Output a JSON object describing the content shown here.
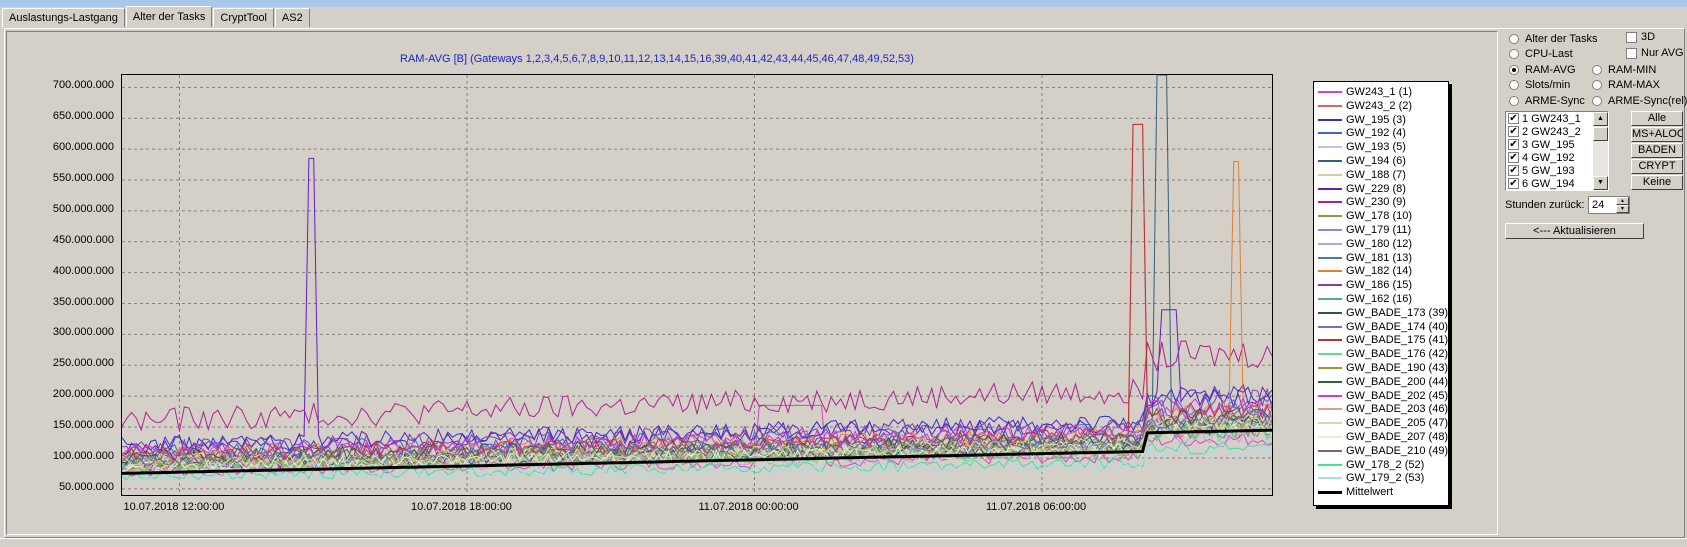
{
  "tabs": [
    {
      "label": "Auslastungs-Lastgang",
      "active": false
    },
    {
      "label": "Alter der Tasks",
      "active": true
    },
    {
      "label": "CryptTool",
      "active": false
    },
    {
      "label": "AS2",
      "active": false
    }
  ],
  "controls": {
    "radios": [
      {
        "label": "Alter der Tasks",
        "checked": false
      },
      {
        "label": "CPU-Last",
        "checked": false
      },
      {
        "label": "RAM-AVG",
        "checked": true
      },
      {
        "label": "RAM-MIN",
        "checked": false
      },
      {
        "label": "Slots/min",
        "checked": false
      },
      {
        "label": "RAM-MAX",
        "checked": false
      },
      {
        "label": "ARME-Sync",
        "checked": false
      },
      {
        "label": "ARME-Sync(rel)",
        "checked": false
      }
    ],
    "checks": [
      {
        "label": "3D",
        "checked": false
      },
      {
        "label": "Nur AVG",
        "checked": false
      }
    ],
    "gateway_list": [
      {
        "label": "1 GW243_1",
        "checked": true
      },
      {
        "label": "2 GW243_2",
        "checked": true
      },
      {
        "label": "3 GW_195",
        "checked": true
      },
      {
        "label": "4 GW_192",
        "checked": true
      },
      {
        "label": "5 GW_193",
        "checked": true
      },
      {
        "label": "6 GW_194",
        "checked": true
      }
    ],
    "buttons": {
      "all": "Alle",
      "ms_aloc": "MS+ALOC",
      "baden": "BADEN",
      "crypt": "CRYPT",
      "none": "Keine",
      "refresh": "<--- Aktualisieren"
    },
    "hours_label": "Stunden zurück:",
    "hours_value": "24"
  },
  "chart_data": {
    "type": "line",
    "title": "RAM-AVG [B] (Gateways 1,2,3,4,5,6,7,8,9,10,11,12,13,14,15,16,39,40,41,42,43,44,45,46,47,48,49,52,53)",
    "xlabel": "",
    "ylabel": "",
    "ylim": [
      40000000,
      720000000
    ],
    "xlim_hours": [
      0,
      24
    ],
    "grid": true,
    "legend_position": "right",
    "y_ticks": [
      "700.000.000",
      "650.000.000",
      "600.000.000",
      "550.000.000",
      "500.000.000",
      "450.000.000",
      "400.000.000",
      "350.000.000",
      "300.000.000",
      "250.000.000",
      "200.000.000",
      "150.000.000",
      "100.000.000",
      "50.000.000"
    ],
    "x_ticks": [
      {
        "label": "10.07.2018 12:00:00",
        "hour": 1.2
      },
      {
        "label": "10.07.2018 18:00:00",
        "hour": 7.2
      },
      {
        "label": "11.07.2018 00:00:00",
        "hour": 13.2
      },
      {
        "label": "11.07.2018 06:00:00",
        "hour": 19.2
      }
    ],
    "series": [
      {
        "name": "GW243_1 (1)",
        "color": "#e040c0",
        "base": 78000000,
        "spikes": [
          [
            13.3,
            14.6,
            185000000
          ]
        ]
      },
      {
        "name": "GW243_2 (2)",
        "color": "#e06060",
        "base": 85000000,
        "spikes": [
          [
            21.1,
            21.3,
            640000000
          ]
        ]
      },
      {
        "name": "GW_195 (3)",
        "color": "#3030d0",
        "base": 120000000,
        "spikes": []
      },
      {
        "name": "GW_192 (4)",
        "color": "#4060e0",
        "base": 110000000,
        "spikes": []
      },
      {
        "name": "GW_193 (5)",
        "color": "#c0c0e0",
        "base": 95000000,
        "spikes": []
      },
      {
        "name": "GW_194 (6)",
        "color": "#306080",
        "base": 100000000,
        "spikes": [
          [
            21.6,
            21.8,
            720000000
          ]
        ]
      },
      {
        "name": "GW_188 (7)",
        "color": "#d0d0a0",
        "base": 90000000,
        "spikes": []
      },
      {
        "name": "GW_229 (8)",
        "color": "#6020c0",
        "base": 120000000,
        "spikes": [
          [
            3.9,
            4.0,
            585000000
          ],
          [
            21.7,
            22.0,
            340000000
          ]
        ]
      },
      {
        "name": "GW_230 (9)",
        "color": "#b02090",
        "base": 160000000,
        "spikes": []
      },
      {
        "name": "GW_178 (10)",
        "color": "#80a040",
        "base": 88000000,
        "spikes": []
      },
      {
        "name": "GW_179 (11)",
        "color": "#a080c0",
        "base": 98000000,
        "spikes": []
      },
      {
        "name": "GW_180 (12)",
        "color": "#c0a0e0",
        "base": 82000000,
        "spikes": []
      },
      {
        "name": "GW_181 (13)",
        "color": "#4080a0",
        "base": 92000000,
        "spikes": []
      },
      {
        "name": "GW_182 (14)",
        "color": "#e08030",
        "base": 105000000,
        "spikes": [
          [
            23.2,
            23.3,
            580000000
          ]
        ]
      },
      {
        "name": "GW_186 (15)",
        "color": "#8040a0",
        "base": 115000000,
        "spikes": []
      },
      {
        "name": "GW_162 (16)",
        "color": "#60a0a0",
        "base": 86000000,
        "spikes": []
      },
      {
        "name": "GW_BADE_173 (39)",
        "color": "#305060",
        "base": 90000000,
        "spikes": []
      },
      {
        "name": "GW_BADE_174 (40)",
        "color": "#7070d0",
        "base": 97000000,
        "spikes": []
      },
      {
        "name": "GW_BADE_175 (41)",
        "color": "#c03030",
        "base": 103000000,
        "spikes": [
          [
            21.1,
            21.3,
            640000000
          ]
        ]
      },
      {
        "name": "GW_BADE_176 (42)",
        "color": "#60e080",
        "base": 84000000,
        "spikes": []
      },
      {
        "name": "GW_BADE_190 (43)",
        "color": "#90a030",
        "base": 93000000,
        "spikes": []
      },
      {
        "name": "GW_BADE_200 (44)",
        "color": "#306040",
        "base": 101000000,
        "spikes": []
      },
      {
        "name": "GW_BADE_202 (45)",
        "color": "#e030e0",
        "base": 108000000,
        "spikes": []
      },
      {
        "name": "GW_BADE_203 (46)",
        "color": "#e0a080",
        "base": 89000000,
        "spikes": []
      },
      {
        "name": "GW_BADE_205 (47)",
        "color": "#d0e0a0",
        "base": 94000000,
        "spikes": []
      },
      {
        "name": "GW_BADE_207 (48)",
        "color": "#e0f0d0",
        "base": 87000000,
        "spikes": []
      },
      {
        "name": "GW_BADE_210 (49)",
        "color": "#806080",
        "base": 99000000,
        "spikes": []
      },
      {
        "name": "GW_178_2 (52)",
        "color": "#40e0a0",
        "base": 70000000,
        "spikes": []
      },
      {
        "name": "GW_179_2 (53)",
        "color": "#a0e0f0",
        "base": 66000000,
        "spikes": []
      },
      {
        "name": "Mittelwert",
        "color": "#000000",
        "base": 90000000,
        "spikes": [],
        "bold": true
      }
    ]
  }
}
